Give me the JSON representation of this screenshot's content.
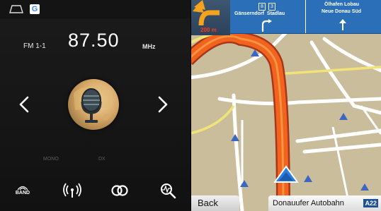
{
  "radio": {
    "google_badge": "G",
    "band_label": "FM 1-1",
    "frequency": "87.50",
    "unit": "MHz",
    "mono_label": "MONO",
    "dx_label": "DX",
    "band_button_label": "BAND",
    "icons": [
      "home-icon",
      "chevron-left-icon",
      "chevron-right-icon",
      "microphone-icon",
      "signal-antenna-icon",
      "stereo-icon",
      "search-scan-icon"
    ]
  },
  "navigation": {
    "distance": "200 m",
    "sign_left": {
      "route_a": "8",
      "route_b": "3",
      "text": "Gänserndorf  Stadlau"
    },
    "sign_right": {
      "line1": "Ölhafen Lobau",
      "line2": "Neue Donau Süd"
    },
    "back_label": "Back",
    "street_name": "Donauufer Autobahn",
    "road_number": "A22",
    "colors": {
      "route": "#f25a1a",
      "map_bg": "#cabf9c",
      "sign_bg": "#2a6fb8"
    }
  }
}
